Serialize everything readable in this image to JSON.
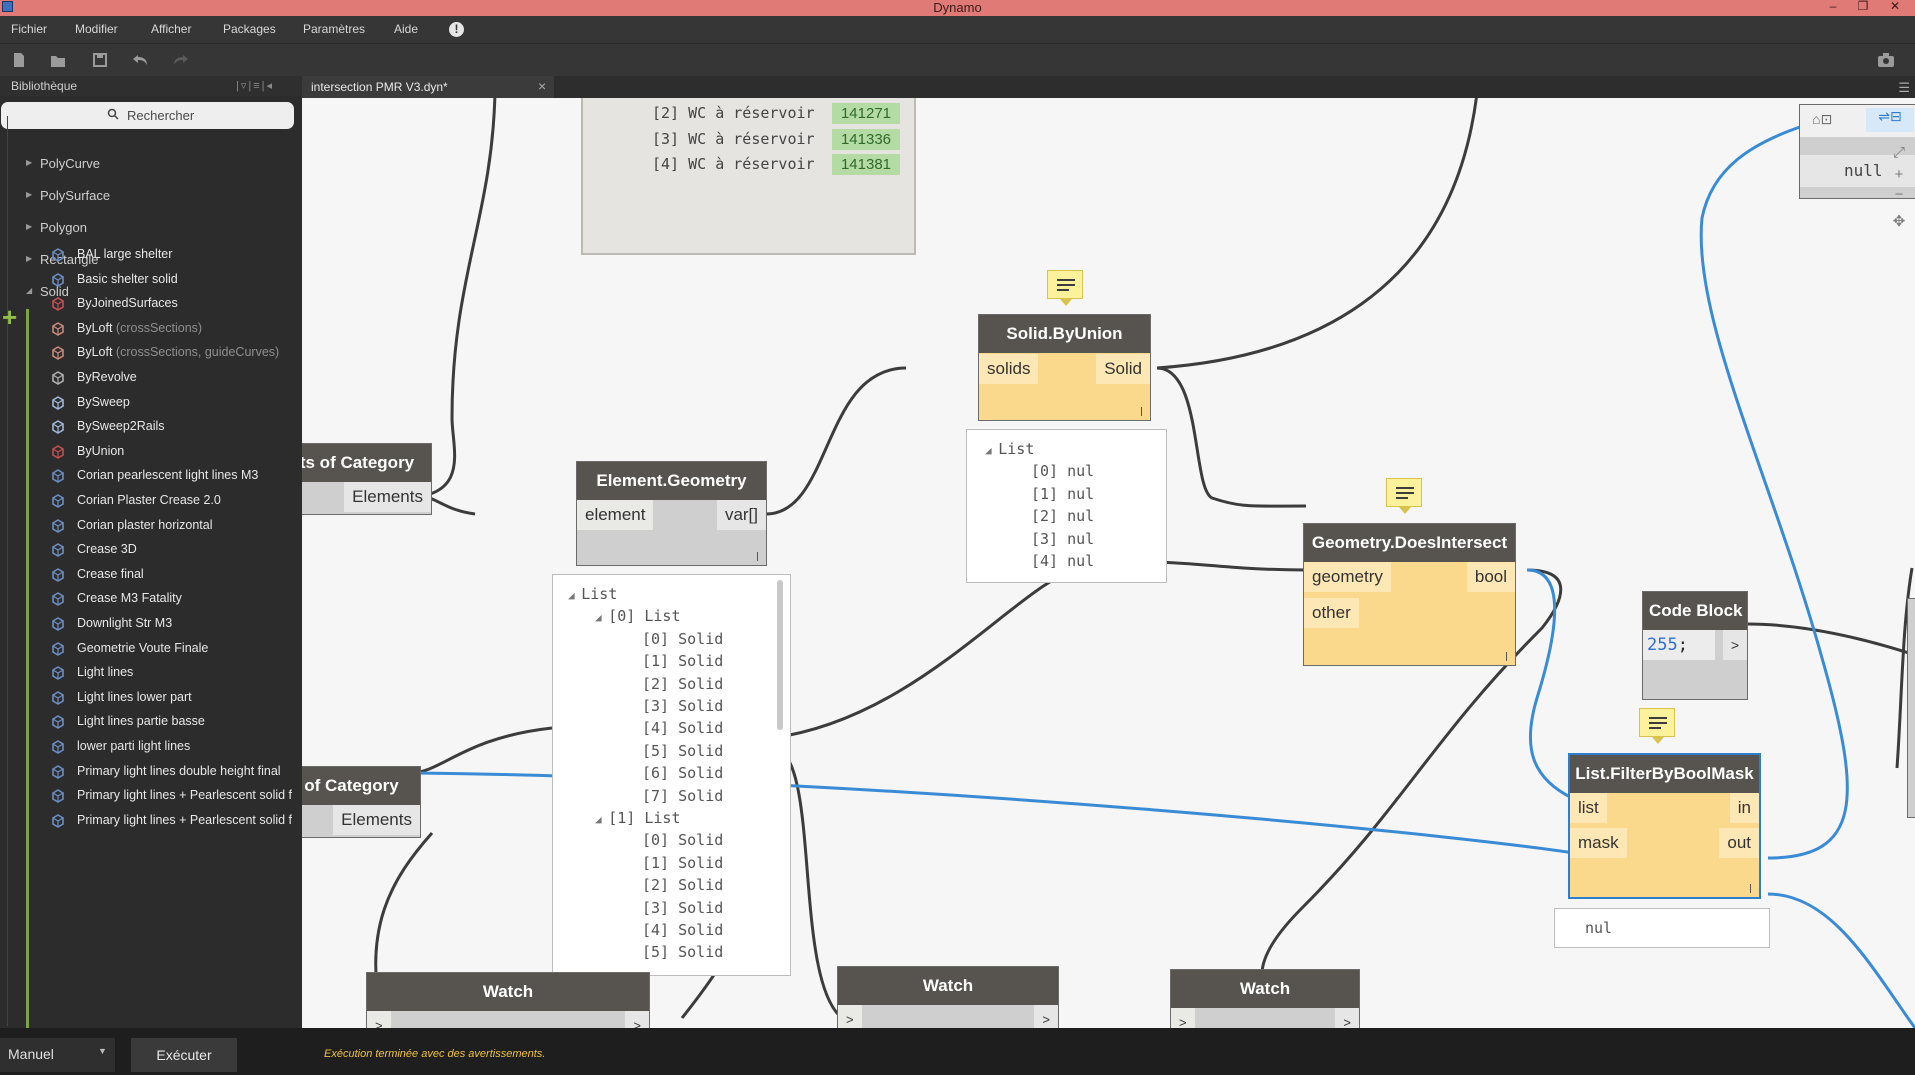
{
  "window": {
    "title": "Dynamo"
  },
  "menu": [
    "Fichier",
    "Modifier",
    "Afficher",
    "Packages",
    "Paramètres",
    "Aide"
  ],
  "library": {
    "header": "Bibliothèque",
    "search_placeholder": "Rechercher",
    "categories": [
      "PolyCurve",
      "PolySurface",
      "Polygon",
      "Rectangle",
      "Solid"
    ],
    "items": [
      {
        "name": "BAL large shelter",
        "sub": "",
        "icon": "custom-node-icon"
      },
      {
        "name": "Basic shelter solid",
        "sub": "",
        "icon": "custom-node-icon"
      },
      {
        "name": "ByJoinedSurfaces",
        "sub": "",
        "icon": "joined-surfaces-icon"
      },
      {
        "name": "ByLoft",
        "sub": "(crossSections)",
        "icon": "loft-icon"
      },
      {
        "name": "ByLoft",
        "sub": "(crossSections, guideCurves)",
        "icon": "loft-icon"
      },
      {
        "name": "ByRevolve",
        "sub": "",
        "icon": "revolve-icon"
      },
      {
        "name": "BySweep",
        "sub": "",
        "icon": "sweep-icon"
      },
      {
        "name": "BySweep2Rails",
        "sub": "",
        "icon": "sweep-icon"
      },
      {
        "name": "ByUnion",
        "sub": "",
        "icon": "union-icon"
      },
      {
        "name": "Corian  pearlescent  light lines M3",
        "sub": "",
        "icon": "custom-node-icon"
      },
      {
        "name": "Corian Plaster Crease 2.0",
        "sub": "",
        "icon": "custom-node-icon"
      },
      {
        "name": "Corian plaster horizontal",
        "sub": "",
        "icon": "custom-node-icon"
      },
      {
        "name": "Crease 3D",
        "sub": "",
        "icon": "custom-node-icon"
      },
      {
        "name": "Crease final",
        "sub": "",
        "icon": "custom-node-icon"
      },
      {
        "name": "Crease M3 Fatality",
        "sub": "",
        "icon": "custom-node-icon"
      },
      {
        "name": "Downlight Str M3",
        "sub": "",
        "icon": "custom-node-icon"
      },
      {
        "name": "Geometrie Voute Finale",
        "sub": "",
        "icon": "custom-node-icon"
      },
      {
        "name": "Light lines",
        "sub": "",
        "icon": "custom-node-icon"
      },
      {
        "name": "Light lines lower part",
        "sub": "",
        "icon": "custom-node-icon"
      },
      {
        "name": "Light lines partie basse",
        "sub": "",
        "icon": "custom-node-icon"
      },
      {
        "name": "lower parti light lines",
        "sub": "",
        "icon": "custom-node-icon"
      },
      {
        "name": "Primary light lines  double height final",
        "sub": "",
        "icon": "custom-node-icon"
      },
      {
        "name": "Primary light lines + Pearlescent solid f",
        "sub": "",
        "icon": "custom-node-icon"
      },
      {
        "name": "Primary light lines + Pearlescent solid f",
        "sub": "",
        "icon": "custom-node-icon"
      }
    ]
  },
  "tab": {
    "label": "intersection PMR V3.dyn*",
    "close": "×"
  },
  "canvas": {
    "top_watch": [
      {
        "label": "[2] WC à réservoir",
        "value": "141271"
      },
      {
        "label": "[3] WC à réservoir",
        "value": "141336"
      },
      {
        "label": "[4] WC à réservoir",
        "value": "141381"
      }
    ],
    "nodes": {
      "elements_of_category_1": {
        "title": "ts of Category",
        "out": "Elements"
      },
      "elements_of_category_2": {
        "title": "of Category",
        "out": "Elements"
      },
      "element_geometry": {
        "title": "Element.Geometry",
        "in": "element",
        "out": "var[]"
      },
      "solid_byunion": {
        "title": "Solid.ByUnion",
        "in": "solids",
        "out": "Solid"
      },
      "does_intersect": {
        "title": "Geometry.DoesIntersect",
        "in1": "geometry",
        "in2": "other",
        "out": "bool"
      },
      "code_block": {
        "title": "Code Block",
        "code_num": "255",
        "code_semi": ";",
        "out": ">"
      },
      "filter": {
        "title": "List.FilterByBoolMask",
        "in1": "list",
        "in2": "mask",
        "out1": "in",
        "out2": "out"
      },
      "watch1": {
        "title": "Watch",
        "in": ">",
        "out": ">"
      },
      "watch2": {
        "title": "Watch",
        "in": ">",
        "out": ">"
      },
      "watch3": {
        "title": "Watch",
        "in": ">",
        "out": ">"
      },
      "top_right_out": "null"
    },
    "union_preview": [
      "List",
      "[0] nul",
      "[1] nul",
      "[2] nul",
      "[3] nul",
      "[4] nul"
    ],
    "geometry_preview": {
      "root": "List",
      "groups": [
        {
          "label": "[0] List",
          "items": [
            "[0] Solid",
            "[1] Solid",
            "[2] Solid",
            "[3] Solid",
            "[4] Solid",
            "[5] Solid",
            "[6] Solid",
            "[7] Solid"
          ]
        },
        {
          "label": "[1] List",
          "items": [
            "[0] Solid",
            "[1] Solid",
            "[2] Solid",
            "[3] Solid",
            "[4] Solid",
            "[5] Solid"
          ]
        }
      ]
    },
    "filter_preview": "nul"
  },
  "status": {
    "mode": "Manuel",
    "run": "Exécuter",
    "message": "Exécution terminée avec des avertissements."
  },
  "colors": {
    "wire": "#3c3c3c",
    "selected_wire": "#3a8bd6",
    "node_header": "#57534e",
    "node_yellow": "#fbd98c",
    "status_message": "#f0c33c"
  }
}
